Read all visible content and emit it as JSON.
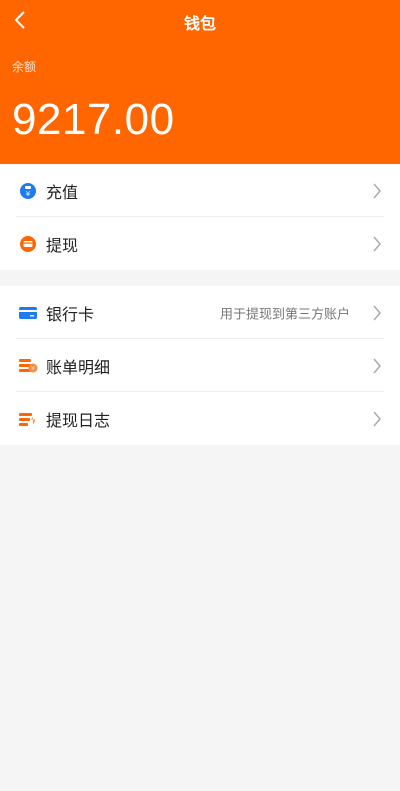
{
  "header": {
    "title": "钱包",
    "back_icon": "chevron-left-icon",
    "background_color": "#ff6600",
    "balance_label": "余额",
    "balance_value": "9217.00"
  },
  "group_1": {
    "items": [
      {
        "label": "充值",
        "icon": "recharge-icon",
        "icon_color": "#1e7bf0"
      },
      {
        "label": "提现",
        "icon": "withdraw-icon",
        "icon_color": "#ff6600"
      }
    ]
  },
  "group_2": {
    "items": [
      {
        "label": "银行卡",
        "hint": "用于提现到第三方账户",
        "icon": "bank-card-icon",
        "icon_color": "#1e7bf0"
      },
      {
        "label": "账单明细",
        "icon": "bill-details-icon",
        "icon_color": "#ff6600"
      },
      {
        "label": "提现日志",
        "icon": "withdraw-log-icon",
        "icon_color": "#ff6600"
      }
    ]
  }
}
